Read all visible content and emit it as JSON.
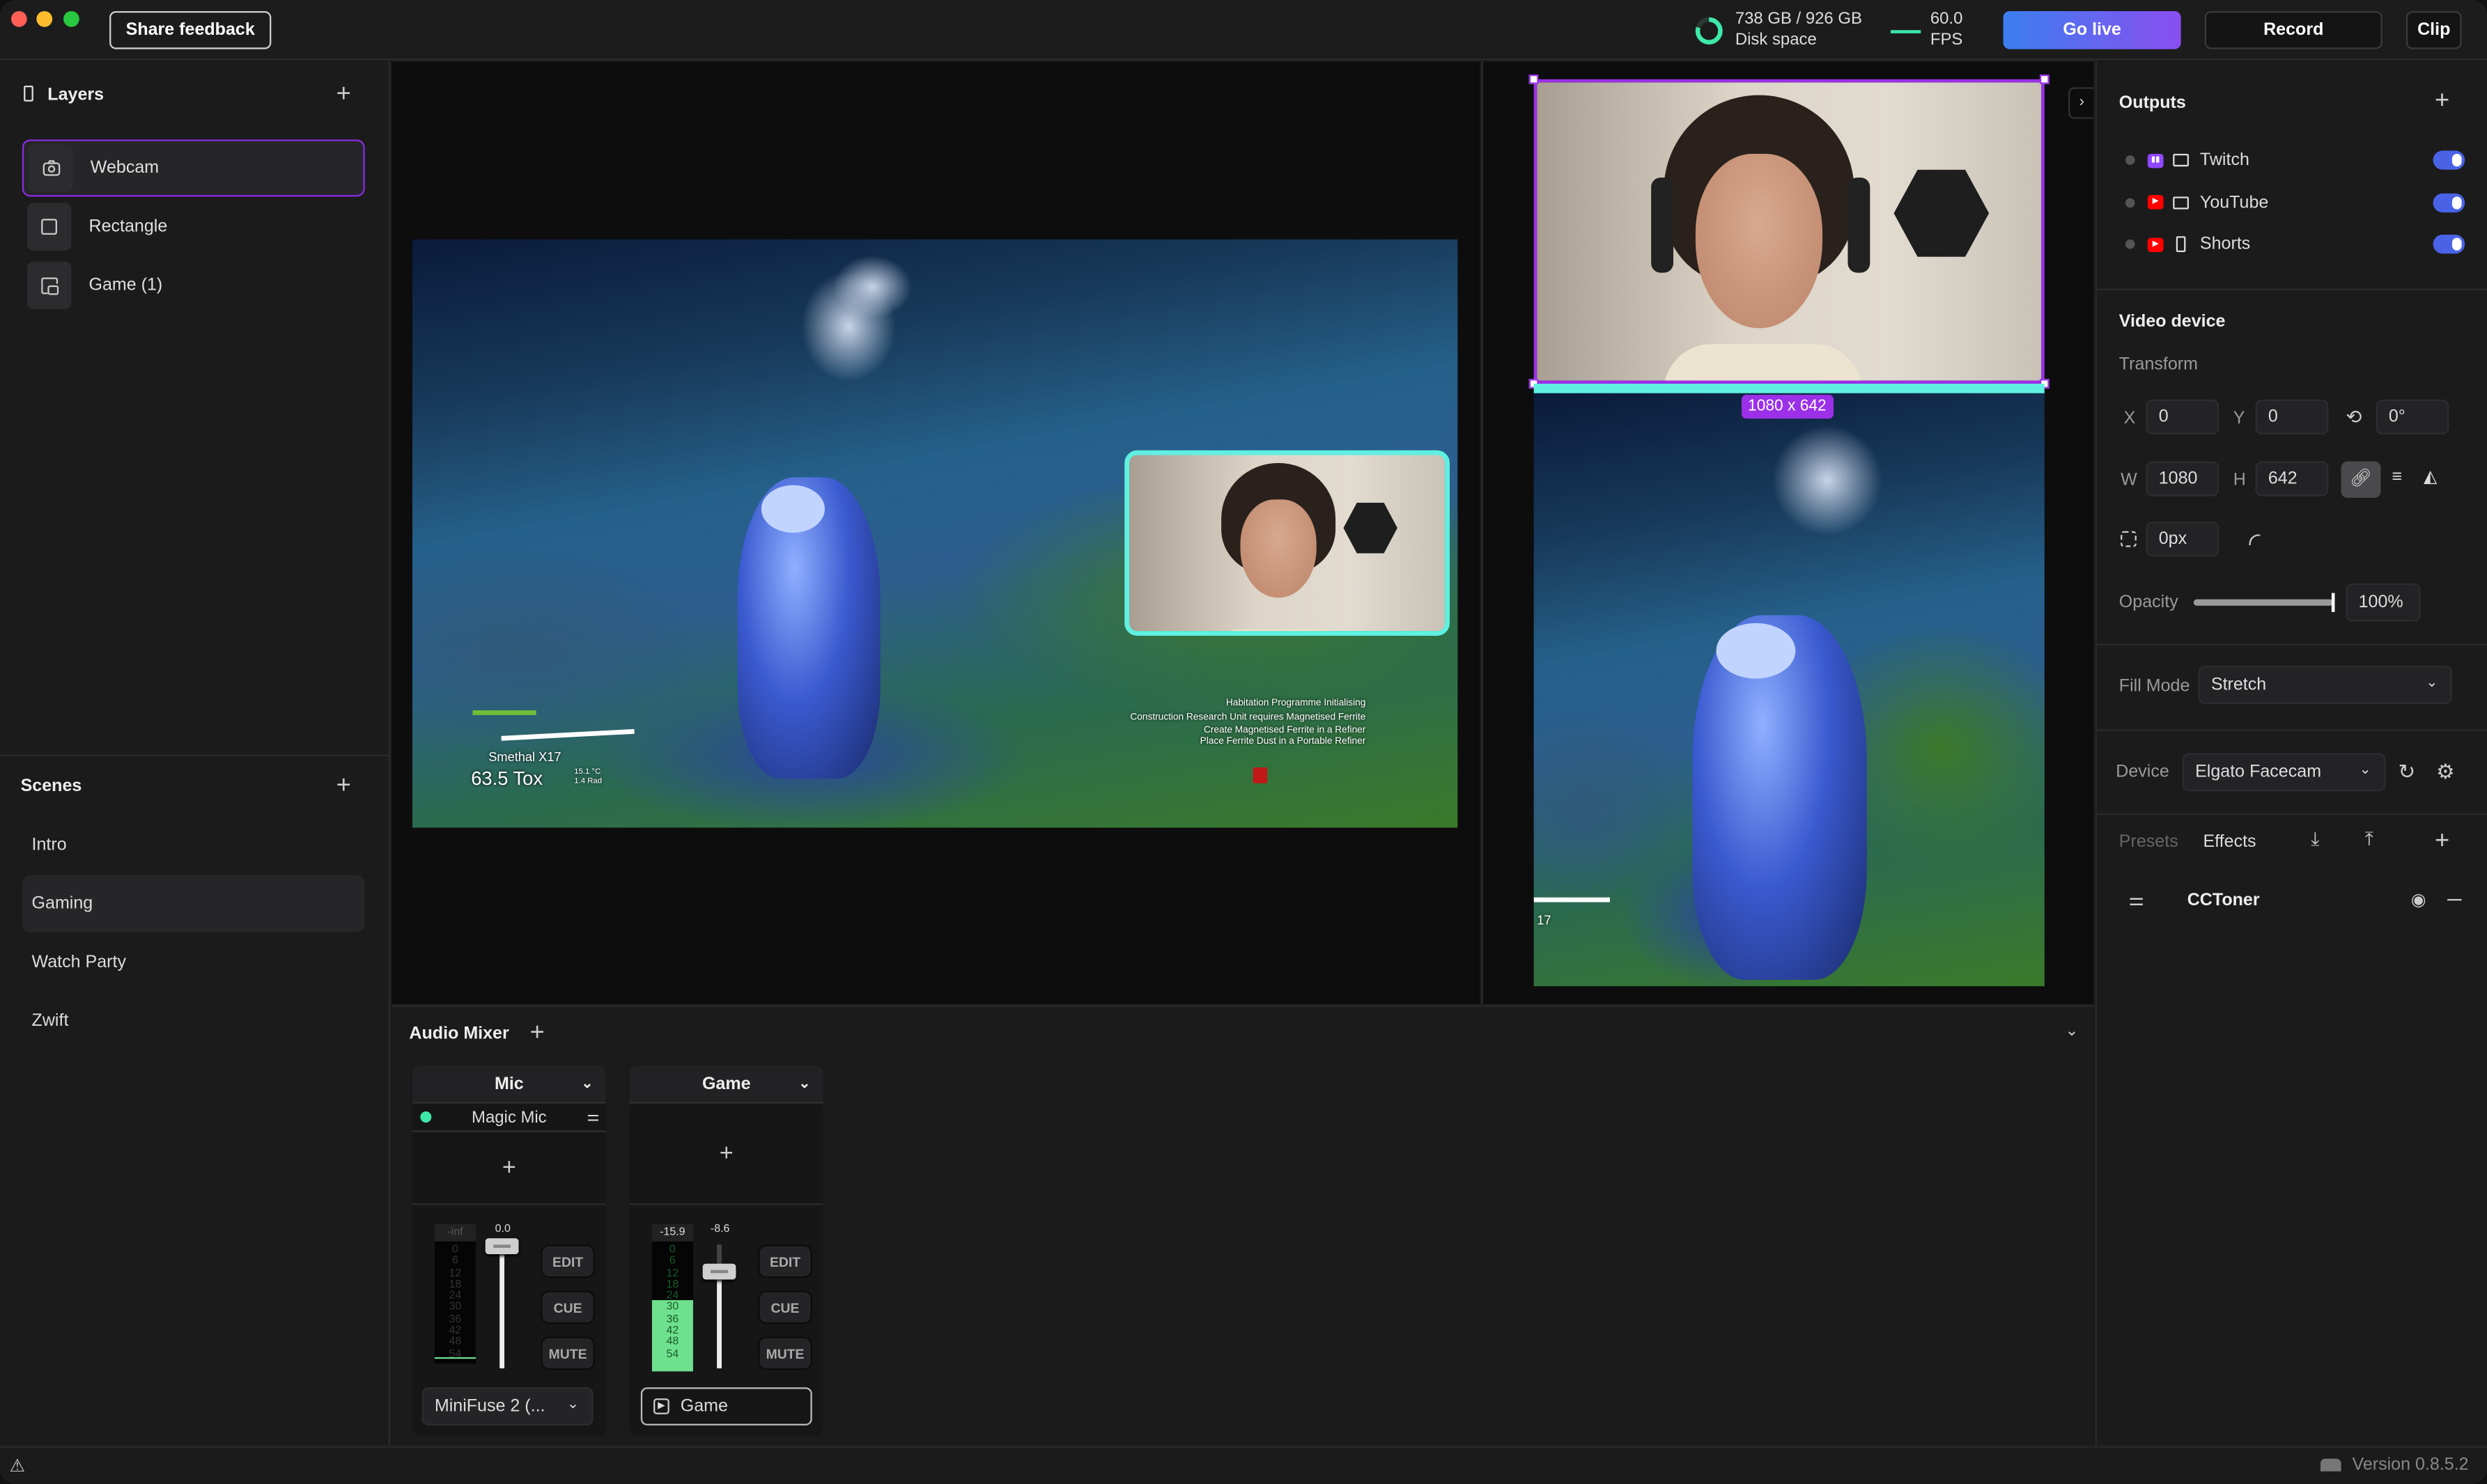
{
  "window": {
    "traffic_lights": [
      "#ff5f57",
      "#febc2e",
      "#28c840"
    ]
  },
  "topbar": {
    "share_feedback": "Share feedback",
    "disk": {
      "value": "738 GB / 926 GB",
      "label": "Disk space",
      "used_fraction": 0.797
    },
    "fps": {
      "value": "60.0",
      "label": "FPS"
    },
    "go_live": "Go live",
    "record": "Record",
    "clip": "Clip"
  },
  "layers": {
    "title": "Layers",
    "items": [
      {
        "label": "Webcam",
        "icon": "camera-icon",
        "selected": true
      },
      {
        "label": "Rectangle",
        "icon": "square-icon"
      },
      {
        "label": "Game (1)",
        "icon": "picture-in-picture-icon"
      }
    ]
  },
  "scenes": {
    "title": "Scenes",
    "items": [
      {
        "label": "Intro"
      },
      {
        "label": "Gaming",
        "selected": true
      },
      {
        "label": "Watch Party"
      },
      {
        "label": "Zwift"
      }
    ]
  },
  "game_hud": {
    "quest_title": "Habitation Programme Initialising",
    "quest_lines": [
      "Construction Research Unit requires Magnetised Ferrite",
      "Create Magnetised Ferrite in a Refiner",
      "Place Ferrite Dust in a Portable Refiner"
    ],
    "planet": "Smethal X17",
    "tox": "63.5 Tox",
    "temp": "15.1 °C",
    "rad": "1.4 Rad",
    "vertical_partial": "17"
  },
  "vertical_preview": {
    "size_badge": "1080 x 642"
  },
  "outputs": {
    "title": "Outputs",
    "items": [
      {
        "label": "Twitch",
        "platform_color": "#9146ff",
        "format": "landscape",
        "enabled": true
      },
      {
        "label": "YouTube",
        "platform_color": "#ff0000",
        "format": "landscape",
        "enabled": true
      },
      {
        "label": "Shorts",
        "platform_color": "#ff0000",
        "format": "portrait",
        "enabled": true
      }
    ]
  },
  "video_device": {
    "title": "Video device",
    "transform_label": "Transform",
    "x_label": "X",
    "x": "0",
    "y_label": "Y",
    "y": "0",
    "rotation": "0°",
    "w_label": "W",
    "w": "1080",
    "h_label": "H",
    "h": "642",
    "corner": "0px",
    "opacity_label": "Opacity",
    "opacity": "100%",
    "opacity_value": 1.0,
    "fill_mode_label": "Fill Mode",
    "fill_mode": "Stretch",
    "device_label": "Device",
    "device": "Elgato Facecam",
    "tabs": [
      "Presets",
      "Effects"
    ],
    "active_tab": "Effects",
    "effects": [
      {
        "label": "CCToner"
      }
    ]
  },
  "audio_mixer": {
    "title": "Audio Mixer",
    "channels": [
      {
        "name": "Mic",
        "filter": "Magic Mic",
        "filter_active_color": "#3ee8a8",
        "peak": "-inf",
        "gain": "0.0",
        "gain_db": 0.0,
        "level_db": null,
        "scale": [
          "0",
          "6",
          "12",
          "18",
          "24",
          "30",
          "36",
          "42",
          "48",
          "54"
        ],
        "edit": "EDIT",
        "cue": "CUE",
        "mute": "MUTE",
        "source": "MiniFuse 2 (..."
      },
      {
        "name": "Game",
        "peak": "-15.9",
        "gain": "-8.6",
        "gain_db": -8.6,
        "level_db": -27,
        "scale": [
          "0",
          "6",
          "12",
          "18",
          "24",
          "30",
          "36",
          "42",
          "48",
          "54"
        ],
        "edit": "EDIT",
        "cue": "CUE",
        "mute": "MUTE",
        "source": "Game"
      }
    ],
    "meter_color": "#6ee08e"
  },
  "statusbar": {
    "version": "Version 0.8.5.2"
  }
}
